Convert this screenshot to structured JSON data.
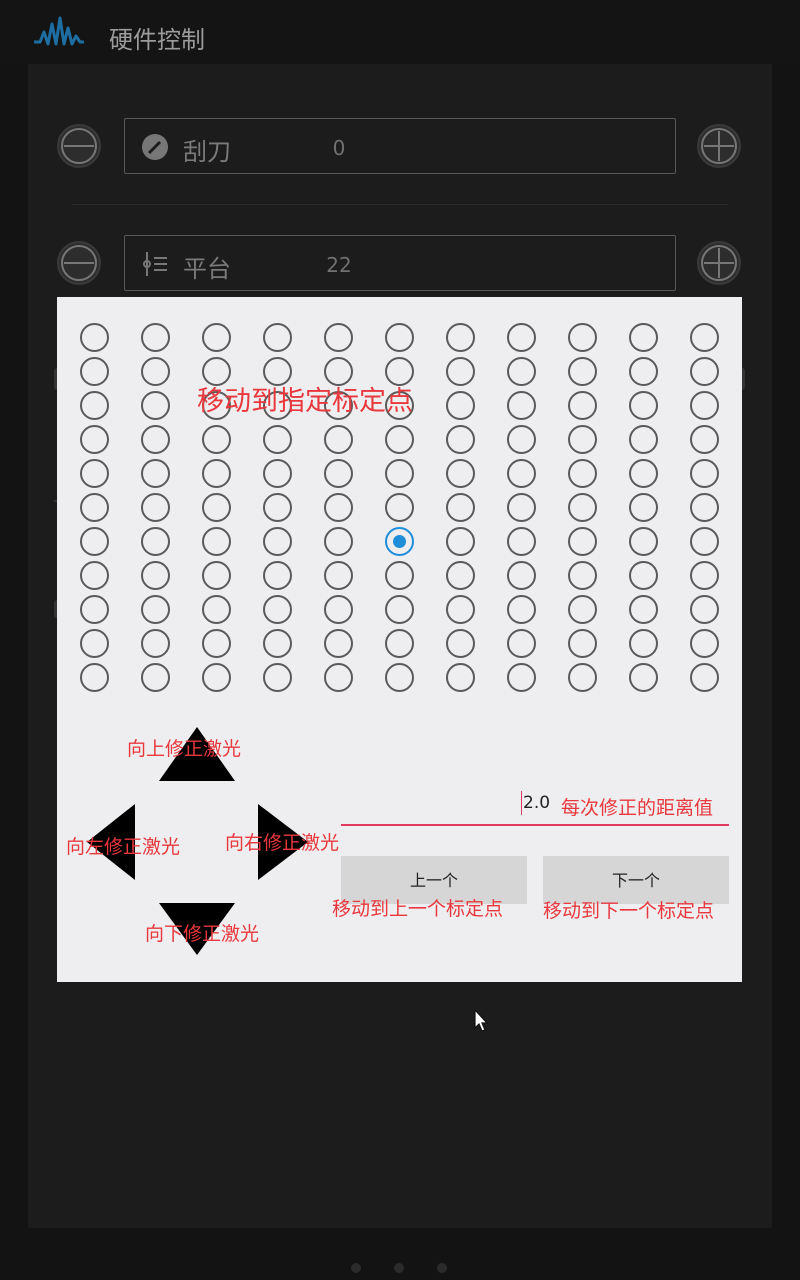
{
  "app": {
    "title": "硬件控制",
    "fields": [
      {
        "label": "刮刀",
        "value": "0",
        "icon": "scraper-icon"
      },
      {
        "label": "平台",
        "value": "22",
        "icon": "platform-icon"
      }
    ]
  },
  "dialog": {
    "title": "移动到指定标定点",
    "grid": {
      "rows": 11,
      "cols": 11,
      "selected_row": 7,
      "selected_col": 6
    },
    "labels": {
      "up": "向上修正激光",
      "left": "向左修正激光",
      "right": "向右修正激光",
      "down": "向下修正激光",
      "step_hint": "每次修正的距离值",
      "prev_hint": "移动到上一个标定点",
      "next_hint": "移动到下一个标定点"
    },
    "step_value": "2.0",
    "prev_button": "上一个",
    "next_button": "下一个"
  },
  "colors": {
    "accent": "#1f8ed8",
    "annotation": "#e8383d",
    "input_underline": "#e03a60",
    "dialog_bg": "#eeeef0"
  }
}
